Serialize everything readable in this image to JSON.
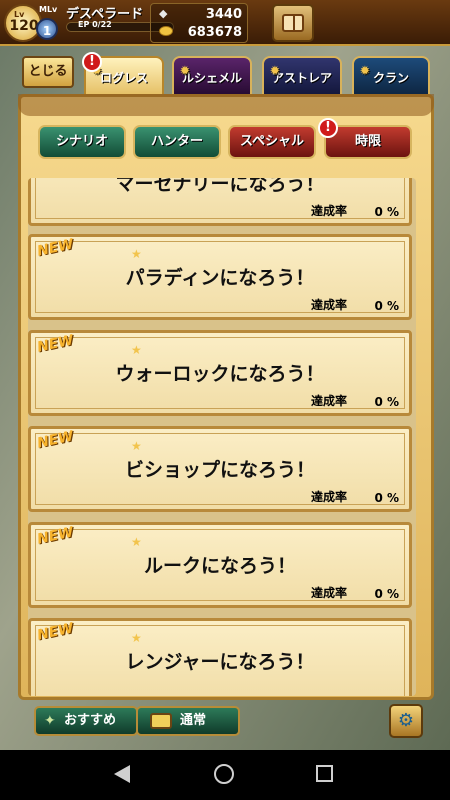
{
  "header": {
    "lv_label": "Lv",
    "level": "120",
    "ml_label": "MLv",
    "mastery_level": "1",
    "player_name": "デスペラード",
    "ep_text": "EP 0/22",
    "ep_fraction": 0.0,
    "gems": "3440",
    "coins": "683678"
  },
  "tabs": {
    "close": "とじる",
    "items": [
      {
        "label": "ログレス",
        "active": true,
        "alert": "!"
      },
      {
        "label": "ルシェメル"
      },
      {
        "label": "アストレア"
      },
      {
        "label": "クラン"
      }
    ]
  },
  "filters": [
    {
      "label": "シナリオ",
      "color": "green"
    },
    {
      "label": "ハンター",
      "color": "green"
    },
    {
      "label": "スペシャル",
      "color": "red"
    },
    {
      "label": "時限",
      "color": "red",
      "alert": "!"
    }
  ],
  "quests": [
    {
      "title": "マーセナリーになろう！",
      "new": false,
      "progress_label": "達成率",
      "progress": "0 %"
    },
    {
      "title": "パラディンになろう！",
      "new": true,
      "new_label": "NEW",
      "progress_label": "達成率",
      "progress": "0 %"
    },
    {
      "title": "ウォーロックになろう！",
      "new": true,
      "new_label": "NEW",
      "progress_label": "達成率",
      "progress": "0 %"
    },
    {
      "title": "ビショップになろう！",
      "new": true,
      "new_label": "NEW",
      "progress_label": "達成率",
      "progress": "0 %"
    },
    {
      "title": "ルークになろう！",
      "new": true,
      "new_label": "NEW",
      "progress_label": "達成率",
      "progress": "0 %"
    },
    {
      "title": "レンジャーになろう！",
      "new": true,
      "new_label": "NEW"
    }
  ],
  "bottom": {
    "recommend": "おすすめ",
    "normal": "通常"
  },
  "colors": {
    "gold": "#dfb45a",
    "green": "#124c36",
    "red": "#6c130f"
  }
}
